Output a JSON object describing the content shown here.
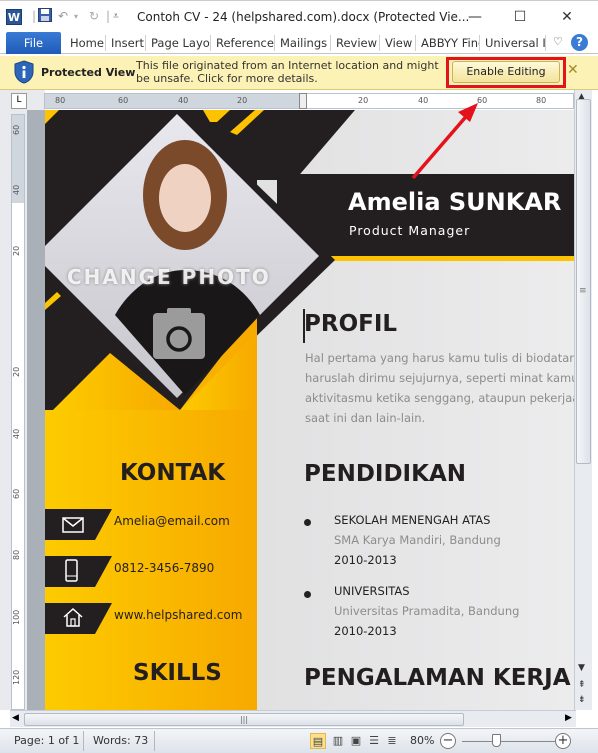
{
  "window": {
    "app_icon": "W",
    "title": "Contoh CV - 24 (helpshared.com).docx (Protected Vie...",
    "quick_access": [
      "save-icon",
      "undo-icon",
      "redo-icon",
      "customize-icon"
    ],
    "controls": {
      "minimize": "—",
      "maximize": "☐",
      "close": "✕"
    }
  },
  "ribbon": {
    "file_label": "File",
    "tabs": [
      "Home",
      "Insert",
      "Page Layo",
      "Reference",
      "Mailings",
      "Review",
      "View",
      "ABBYY Fine",
      "Universal I"
    ],
    "help": "?",
    "minimize_ribbon": "♡"
  },
  "protected_view": {
    "label": "Protected View",
    "message": "This file originated from an Internet location and might be unsafe. Click for more details.",
    "enable_button": "Enable Editing",
    "close": "✕",
    "highlight_color": "#e3121b"
  },
  "rulers": {
    "corner": "L",
    "horizontal_ticks": [
      "80",
      "60",
      "40",
      "20",
      "20",
      "40",
      "60",
      "80"
    ],
    "vertical_ticks": [
      "60",
      "40",
      "20",
      "20",
      "40",
      "60",
      "80",
      "100",
      "120"
    ]
  },
  "cv": {
    "change_photo": "CHANGE PHOTO",
    "name": "Amelia SUNKAR",
    "role": "Product Manager",
    "profil": {
      "heading": "PROFIL",
      "lines": [
        "Hal pertama yang harus kamu tulis di biodatamu",
        "haruslah dirimu sejujurnya, seperti minat kamu,",
        "aktivitasmu ketika senggang, ataupun pekerjaan",
        "saat ini dan lain-lain."
      ]
    },
    "kontak": {
      "heading": "KONTAK",
      "items": [
        {
          "icon": "envelope-icon",
          "text": "Amelia@email.com"
        },
        {
          "icon": "phone-icon",
          "text": "0812-3456-7890"
        },
        {
          "icon": "home-icon",
          "text": "www.helpshared.com"
        }
      ]
    },
    "skills_heading": "SKILLS",
    "pendidikan": {
      "heading": "PENDIDIKAN",
      "items": [
        {
          "title": "SEKOLAH MENENGAH ATAS",
          "school": "SMA Karya Mandiri, Bandung",
          "years": "2010-2013"
        },
        {
          "title": "UNIVERSITAS",
          "school": "Universitas Pramadita, Bandung",
          "years": "2010-2013"
        }
      ]
    },
    "pengalaman_heading": "PENGALAMAN KERJA",
    "colors": {
      "dark": "#231f20",
      "yellow": "#fdc300",
      "orange": "#f8a800"
    }
  },
  "status": {
    "page": "Page: 1 of 1",
    "words": "Words: 73",
    "zoom": "80%",
    "zoom_level_percent": 80,
    "zoom_out": "−",
    "zoom_in": "+"
  }
}
